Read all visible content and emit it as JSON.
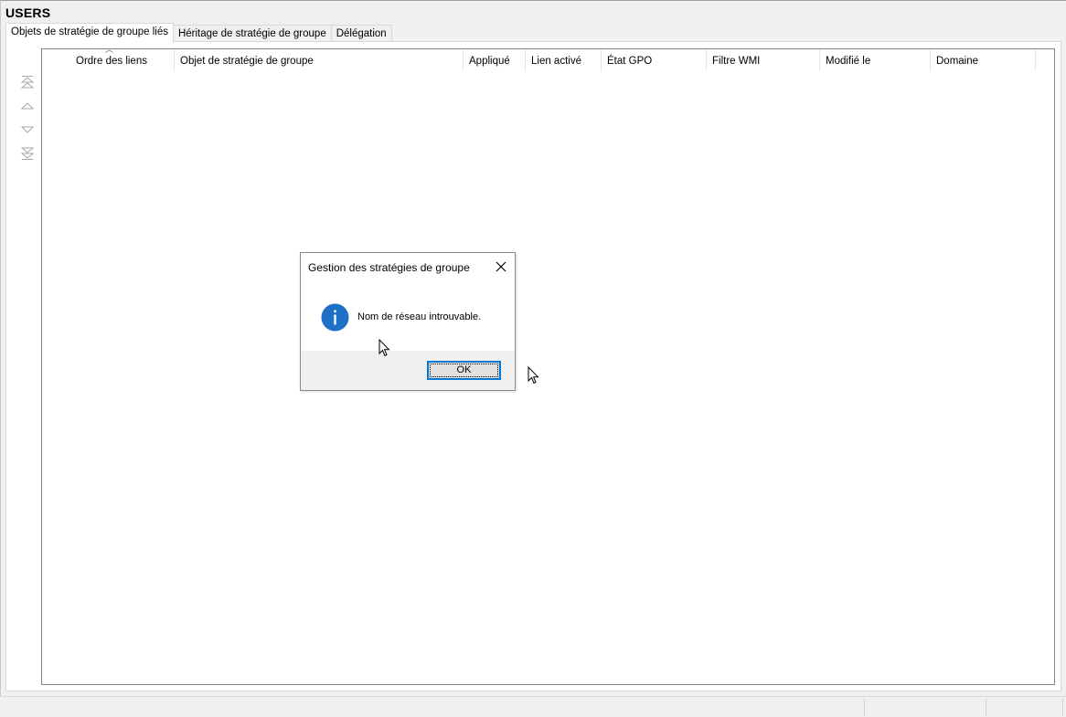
{
  "window": {
    "title": "USERS"
  },
  "tabs": [
    {
      "label": "Objets de stratégie de groupe liés",
      "active": true
    },
    {
      "label": "Héritage de stratégie de groupe",
      "active": false
    },
    {
      "label": "Délégation",
      "active": false
    }
  ],
  "side_buttons": [
    {
      "icon": "move-to-top-icon"
    },
    {
      "icon": "move-up-icon"
    },
    {
      "icon": "move-down-icon"
    },
    {
      "icon": "move-to-bottom-icon"
    }
  ],
  "list": {
    "columns": [
      "Ordre des liens",
      "Objet de stratégie de groupe",
      "Appliqué",
      "Lien activé",
      "État GPO",
      "Filtre WMI",
      "Modifié le",
      "Domaine"
    ],
    "sorted_column": "Ordre des liens",
    "rows": []
  },
  "dialog": {
    "title": "Gestion des stratégies de groupe",
    "icon": "info-icon",
    "message": "Nom de réseau introuvable.",
    "ok_label": "OK"
  },
  "colors": {
    "accent": "#0078d7",
    "info_icon": "#1e6fc8"
  }
}
